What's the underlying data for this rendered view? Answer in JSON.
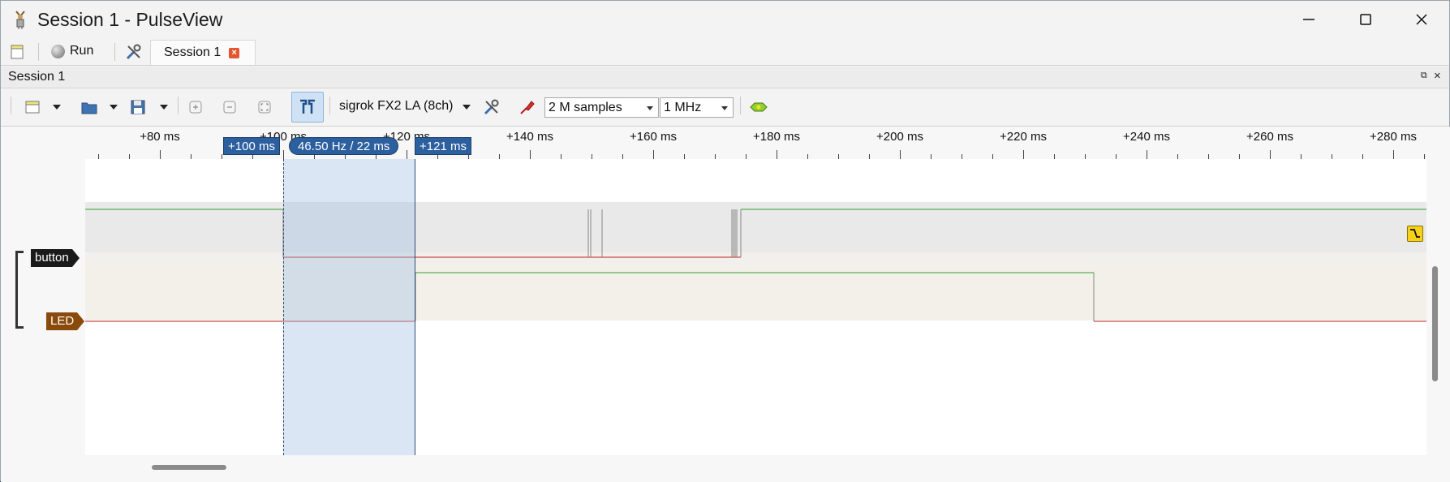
{
  "window": {
    "title": "Session 1 - PulseView",
    "controls": [
      "minimize-icon",
      "maximize-icon",
      "close-icon"
    ]
  },
  "tabbar": {
    "run_label": "Run",
    "session_tab_label": "Session 1",
    "tab_close_glyph": "×"
  },
  "dock": {
    "title": "Session 1",
    "float_glyph": "⧉",
    "close_glyph": "✕"
  },
  "toolbar": {
    "device_label": "sigrok FX2 LA (8ch)",
    "samples_value": "2 M samples",
    "samplerate_value": "1 MHz"
  },
  "ruler": {
    "labels": [
      "+80 ms",
      "+100 ms",
      "+120 ms",
      "+140 ms",
      "+160 ms",
      "+180 ms",
      "+200 ms",
      "+220 ms",
      "+240 ms",
      "+260 ms",
      "+280 ms"
    ]
  },
  "cursors": {
    "left_label": "+100 ms",
    "measure_label": "46.50 Hz / 22 ms",
    "right_label": "+121 ms"
  },
  "signals": [
    {
      "name": "button",
      "color": "#1a1a1a"
    },
    {
      "name": "LED",
      "color": "#8a4a0c"
    }
  ],
  "colors": {
    "high_trace": "#2fa02f",
    "low_trace": "#c02020",
    "cursor_flag": "#2c5f9e",
    "accent_toggle": "#cfe2f5"
  }
}
